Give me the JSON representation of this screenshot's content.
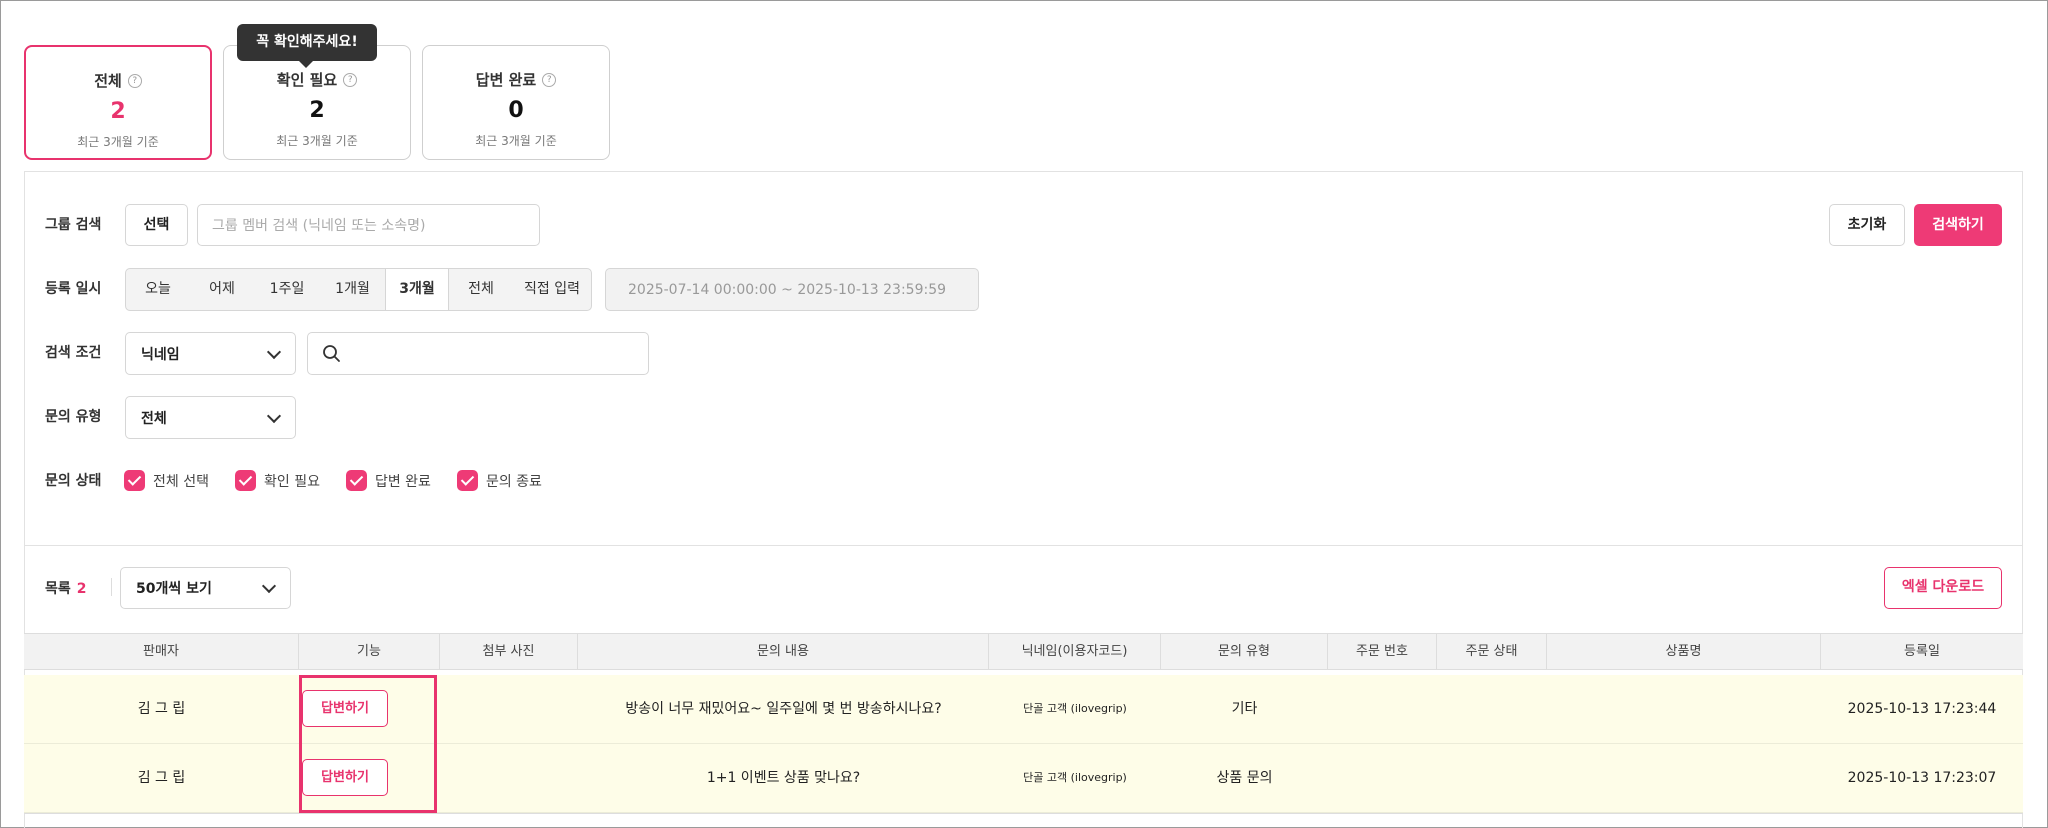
{
  "tooltip": "꼭 확인해주세요!",
  "stats": [
    {
      "title": "전체",
      "value": "2",
      "sub": "최근 3개월 기준"
    },
    {
      "title": "확인 필요",
      "value": "2",
      "sub": "최근 3개월 기준"
    },
    {
      "title": "답변 완료",
      "value": "0",
      "sub": "최근 3개월 기준"
    }
  ],
  "help_glyph": "?",
  "search": {
    "group_label": "그룹 검색",
    "group_select_btn": "선택",
    "group_placeholder": "그룹 멤버 검색 (닉네임 또는 소속명)",
    "reset_btn": "초기화",
    "search_btn": "검색하기",
    "date_label": "등록 일시",
    "date_options": [
      "오늘",
      "어제",
      "1주일",
      "1개월",
      "3개월",
      "전체",
      "직접 입력"
    ],
    "date_selected": "3개월",
    "date_range": "2025-07-14 00:00:00 ~ 2025-10-13 23:59:59",
    "cond_label": "검색 조건",
    "cond_value": "닉네임",
    "type_label": "문의 유형",
    "type_value": "전체",
    "status_label": "문의 상태",
    "status_checks": [
      "전체 선택",
      "확인 필요",
      "답변 완료",
      "문의 종료"
    ]
  },
  "list": {
    "label": "목록",
    "count": "2",
    "page_size": "50개씩 보기",
    "excel_btn": "엑셀 다운로드"
  },
  "table": {
    "headers": [
      "판매자",
      "기능",
      "첨부 사진",
      "문의 내용",
      "닉네임(이용자코드)",
      "문의 유형",
      "주문 번호",
      "주문 상태",
      "상품명",
      "등록일"
    ],
    "rows": [
      {
        "seller": "김 그 립",
        "action": "답변하기",
        "photo": "",
        "content": "방송이 너무 재밌어요~ 일주일에 몇 번 방송하시나요?",
        "nickname": "단골 고객 (ilovegrip)",
        "type": "기타",
        "order_no": "",
        "order_status": "",
        "product": "",
        "date": "2025-10-13 17:23:44"
      },
      {
        "seller": "김 그 립",
        "action": "답변하기",
        "photo": "",
        "content": "1+1 이벤트 상품 맞나요?",
        "nickname": "단골 고객 (ilovegrip)",
        "type": "상품 문의",
        "order_no": "",
        "order_status": "",
        "product": "",
        "date": "2025-10-13 17:23:07"
      }
    ]
  },
  "colors": {
    "accent": "#ee3a76",
    "row_highlight": "#fefde8"
  }
}
